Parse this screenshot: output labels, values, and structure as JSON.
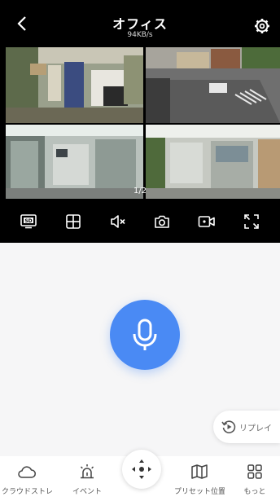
{
  "header": {
    "title": "オフィス",
    "data_rate": "94KB/s"
  },
  "grid": {
    "page_indicator": "1/2"
  },
  "toolbar": {
    "buttons": [
      {
        "icon": "sd-icon"
      },
      {
        "icon": "grid-layout-icon"
      },
      {
        "icon": "mute-icon"
      },
      {
        "icon": "camera-snapshot-icon"
      },
      {
        "icon": "video-record-icon"
      },
      {
        "icon": "fullscreen-icon"
      }
    ]
  },
  "main": {
    "mic_icon": "microphone-icon",
    "replay_label": "リプレイ"
  },
  "bottom_nav": {
    "items": [
      {
        "label": "クラウドストレー",
        "icon": "cloud-icon"
      },
      {
        "label": "イベント",
        "icon": "alarm-icon"
      },
      {
        "label": "",
        "icon": "ptz-direction-icon"
      },
      {
        "label": "プリセット位置",
        "icon": "map-icon"
      },
      {
        "label": "もっと",
        "icon": "grid-more-icon"
      }
    ]
  },
  "colors": {
    "accent": "#4a8af4",
    "header_bg": "#000000",
    "background": "#f6f6f7"
  }
}
